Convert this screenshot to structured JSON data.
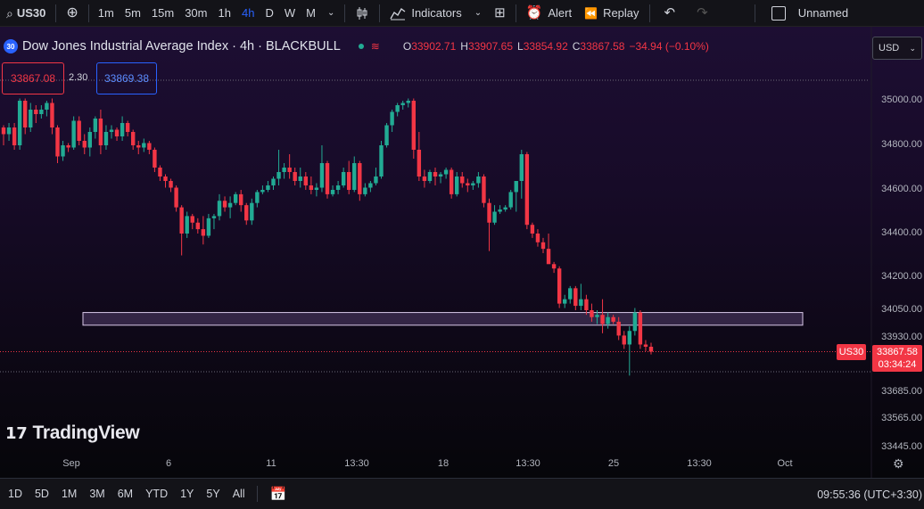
{
  "toolbar": {
    "symbol": "US30",
    "timeframes": [
      "1m",
      "5m",
      "15m",
      "30m",
      "1h",
      "4h",
      "D",
      "W",
      "M"
    ],
    "active_timeframe": "4h",
    "indicators_label": "Indicators",
    "alert_label": "Alert",
    "replay_label": "Replay",
    "layout_name": "Unnamed"
  },
  "legend": {
    "badge": "30",
    "title": "Dow Jones Industrial Average Index · 4h · BLACKBULL",
    "ohlc": [
      {
        "k": "O",
        "v": "33902.71"
      },
      {
        "k": "H",
        "v": "33907.65"
      },
      {
        "k": "L",
        "v": "33854.92"
      },
      {
        "k": "C",
        "v": "33867.58"
      },
      {
        "k": "",
        "v": "−34.94 (−0.10%)"
      }
    ],
    "currency": "USD"
  },
  "trade": {
    "sell_price": "33867.08",
    "spread": "2.30",
    "buy_price": "33869.38"
  },
  "branding": {
    "logo_text": "TradingView"
  },
  "price_axis": {
    "labels": [
      "35000.00",
      "34800.00",
      "34600.00",
      "34400.00",
      "34200.00",
      "34050.00",
      "33930.00",
      "33685.00",
      "33565.00",
      "33445.00"
    ],
    "values": [
      35000,
      34800,
      34600,
      34400,
      34200,
      34050,
      33930,
      33685,
      33565,
      33445
    ],
    "symbol_tag": "US30",
    "last_price": "33867.58",
    "countdown": "03:34:24"
  },
  "time_axis": {
    "labels": [
      "Sep",
      "6",
      "11",
      "13:30",
      "18",
      "13:30",
      "25",
      "13:30",
      "Oct"
    ]
  },
  "bottom": {
    "ranges": [
      "1D",
      "5D",
      "1M",
      "3M",
      "6M",
      "YTD",
      "1Y",
      "5Y",
      "All"
    ],
    "clock": "09:55:36 (UTC+3:30)"
  },
  "colors": {
    "up": "#22ab94",
    "down": "#f23645",
    "accent": "#2962ff",
    "zone_fill": "#3a2a4e",
    "zone_border": "#d8c8e8"
  },
  "chart_data": {
    "type": "candlestick",
    "zone": {
      "low": 33985,
      "high": 34040
    },
    "last_price": 33867.58,
    "candles": [
      [
        34880,
        34890,
        34800,
        34850
      ],
      [
        34850,
        34900,
        34820,
        34880
      ],
      [
        34880,
        34900,
        34780,
        34800
      ],
      [
        34800,
        35010,
        34780,
        35000
      ],
      [
        35000,
        35010,
        34850,
        34880
      ],
      [
        34880,
        34990,
        34860,
        34960
      ],
      [
        34960,
        34980,
        34900,
        34940
      ],
      [
        34940,
        34980,
        34920,
        34960
      ],
      [
        34960,
        35000,
        34930,
        34990
      ],
      [
        34990,
        35010,
        34850,
        34880
      ],
      [
        34880,
        34890,
        34720,
        34750
      ],
      [
        34750,
        34820,
        34730,
        34800
      ],
      [
        34800,
        34810,
        34770,
        34790
      ],
      [
        34790,
        34930,
        34780,
        34910
      ],
      [
        34910,
        34930,
        34800,
        34820
      ],
      [
        34820,
        34850,
        34760,
        34790
      ],
      [
        34790,
        34880,
        34750,
        34860
      ],
      [
        34860,
        34930,
        34830,
        34920
      ],
      [
        34920,
        34960,
        34760,
        34800
      ],
      [
        34800,
        34890,
        34780,
        34860
      ],
      [
        34860,
        34890,
        34830,
        34870
      ],
      [
        34870,
        34880,
        34820,
        34840
      ],
      [
        34840,
        34930,
        34820,
        34900
      ],
      [
        34900,
        34910,
        34840,
        34860
      ],
      [
        34860,
        34870,
        34780,
        34800
      ],
      [
        34800,
        34820,
        34760,
        34790
      ],
      [
        34790,
        34830,
        34770,
        34810
      ],
      [
        34810,
        34820,
        34760,
        34780
      ],
      [
        34780,
        34790,
        34680,
        34700
      ],
      [
        34700,
        34710,
        34640,
        34660
      ],
      [
        34660,
        34670,
        34610,
        34640
      ],
      [
        34640,
        34650,
        34590,
        34610
      ],
      [
        34610,
        34620,
        34500,
        34520
      ],
      [
        34520,
        34530,
        34300,
        34400
      ],
      [
        34400,
        34500,
        34380,
        34480
      ],
      [
        34480,
        34490,
        34420,
        34450
      ],
      [
        34450,
        34470,
        34400,
        34420
      ],
      [
        34420,
        34480,
        34350,
        34390
      ],
      [
        34390,
        34490,
        34380,
        34470
      ],
      [
        34470,
        34490,
        34420,
        34480
      ],
      [
        34480,
        34580,
        34460,
        34550
      ],
      [
        34550,
        34570,
        34500,
        34520
      ],
      [
        34520,
        34570,
        34470,
        34540
      ],
      [
        34540,
        34590,
        34530,
        34580
      ],
      [
        34580,
        34600,
        34500,
        34530
      ],
      [
        34530,
        34540,
        34440,
        34460
      ],
      [
        34460,
        34560,
        34440,
        34540
      ],
      [
        34540,
        34600,
        34520,
        34590
      ],
      [
        34590,
        34620,
        34580,
        34600
      ],
      [
        34600,
        34640,
        34590,
        34620
      ],
      [
        34620,
        34660,
        34600,
        34650
      ],
      [
        34650,
        34780,
        34620,
        34680
      ],
      [
        34680,
        34720,
        34650,
        34700
      ],
      [
        34700,
        34760,
        34650,
        34680
      ],
      [
        34680,
        34700,
        34620,
        34640
      ],
      [
        34640,
        34700,
        34610,
        34660
      ],
      [
        34660,
        34680,
        34600,
        34620
      ],
      [
        34620,
        34660,
        34580,
        34600
      ],
      [
        34600,
        34630,
        34570,
        34610
      ],
      [
        34610,
        34800,
        34590,
        34720
      ],
      [
        34720,
        34730,
        34560,
        34580
      ],
      [
        34580,
        34620,
        34570,
        34600
      ],
      [
        34600,
        34640,
        34580,
        34620
      ],
      [
        34620,
        34700,
        34610,
        34680
      ],
      [
        34680,
        34730,
        34580,
        34600
      ],
      [
        34600,
        34750,
        34590,
        34720
      ],
      [
        34720,
        34730,
        34550,
        34580
      ],
      [
        34580,
        34630,
        34570,
        34610
      ],
      [
        34610,
        34640,
        34590,
        34630
      ],
      [
        34630,
        34700,
        34620,
        34660
      ],
      [
        34660,
        34820,
        34650,
        34800
      ],
      [
        34800,
        34900,
        34790,
        34890
      ],
      [
        34890,
        34960,
        34860,
        34950
      ],
      [
        34950,
        34990,
        34930,
        34980
      ],
      [
        34980,
        35000,
        34960,
        34990
      ],
      [
        34990,
        35010,
        34970,
        35000
      ],
      [
        35000,
        35010,
        34740,
        34780
      ],
      [
        34780,
        34860,
        34640,
        34660
      ],
      [
        34660,
        34690,
        34610,
        34640
      ],
      [
        34640,
        34690,
        34630,
        34680
      ],
      [
        34680,
        34700,
        34620,
        34660
      ],
      [
        34660,
        34680,
        34630,
        34670
      ],
      [
        34670,
        34700,
        34650,
        34690
      ],
      [
        34690,
        34700,
        34560,
        34580
      ],
      [
        34580,
        34680,
        34570,
        34660
      ],
      [
        34660,
        34680,
        34610,
        34630
      ],
      [
        34630,
        34650,
        34590,
        34620
      ],
      [
        34620,
        34640,
        34600,
        34630
      ],
      [
        34630,
        34680,
        34610,
        34660
      ],
      [
        34660,
        34670,
        34520,
        34540
      ],
      [
        34540,
        34560,
        34320,
        34450
      ],
      [
        34450,
        34530,
        34440,
        34500
      ],
      [
        34500,
        34530,
        34490,
        34510
      ],
      [
        34510,
        34530,
        34500,
        34520
      ],
      [
        34520,
        34600,
        34510,
        34590
      ],
      [
        34590,
        34630,
        34500,
        34640
      ],
      [
        34640,
        34780,
        34560,
        34760
      ],
      [
        34760,
        34770,
        34420,
        34440
      ],
      [
        34440,
        34450,
        34380,
        34400
      ],
      [
        34400,
        34420,
        34340,
        34360
      ],
      [
        34360,
        34380,
        34310,
        34330
      ],
      [
        34330,
        34400,
        34300,
        34260
      ],
      [
        34260,
        34270,
        34220,
        34240
      ],
      [
        34240,
        34250,
        34060,
        34080
      ],
      [
        34080,
        34120,
        34060,
        34100
      ],
      [
        34100,
        34160,
        34080,
        34150
      ],
      [
        34150,
        34160,
        34050,
        34070
      ],
      [
        34070,
        34170,
        34050,
        34100
      ],
      [
        34100,
        34120,
        34030,
        34050
      ],
      [
        34050,
        34080,
        34000,
        34020
      ],
      [
        34020,
        34050,
        33990,
        34030
      ],
      [
        34030,
        34100,
        33950,
        33990
      ],
      [
        33990,
        34040,
        33970,
        34020
      ],
      [
        34020,
        34030,
        33990,
        34000
      ],
      [
        34000,
        34020,
        33920,
        33940
      ],
      [
        33940,
        33960,
        33880,
        33900
      ],
      [
        33900,
        33980,
        33760,
        33960
      ],
      [
        33960,
        34060,
        33940,
        34040
      ],
      [
        34040,
        34050,
        33880,
        33900
      ],
      [
        33900,
        33920,
        33870,
        33890
      ],
      [
        33890,
        33908,
        33855,
        33868
      ]
    ]
  }
}
